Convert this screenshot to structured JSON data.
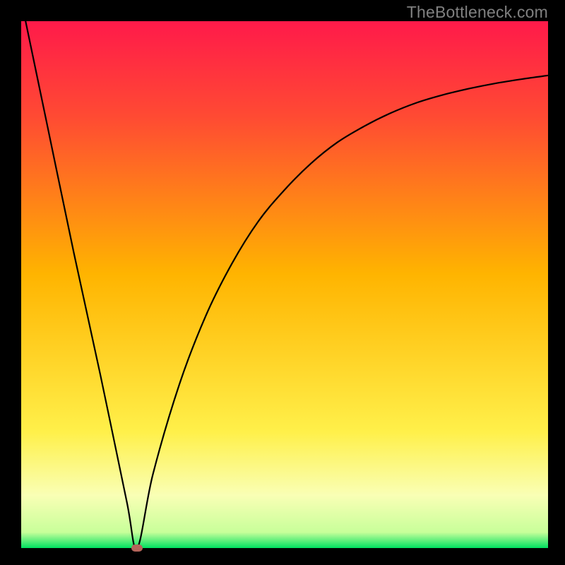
{
  "watermark": "TheBottleneck.com",
  "colors": {
    "frame": "#000000",
    "grad_top": "#ff1a4a",
    "grad_upper": "#ff5a2a",
    "grad_mid": "#ffb400",
    "grad_lower": "#fff04a",
    "grad_pale": "#f9ffb5",
    "grad_green": "#00e060",
    "curve": "#000000",
    "marker": "#b5645a"
  },
  "chart_data": {
    "type": "line",
    "title": "",
    "xlabel": "",
    "ylabel": "",
    "xlim": [
      0,
      100
    ],
    "ylim": [
      0,
      100
    ],
    "curve_min_x": 22,
    "marker": {
      "x": 22,
      "y": 0
    },
    "left_segment": {
      "x": [
        0,
        5,
        10,
        15,
        20,
        22
      ],
      "y": [
        104,
        80,
        56,
        33,
        9,
        0
      ]
    },
    "right_segment": {
      "x": [
        22,
        25,
        30,
        35,
        40,
        45,
        50,
        55,
        60,
        65,
        70,
        75,
        80,
        85,
        90,
        95,
        100
      ],
      "y": [
        0,
        14,
        31,
        44,
        54,
        62,
        68,
        73,
        77,
        80,
        82.5,
        84.5,
        86,
        87.2,
        88.2,
        89,
        89.7
      ]
    },
    "gradient_stops": [
      {
        "pct": 0,
        "color": "#ff1a4a"
      },
      {
        "pct": 18,
        "color": "#ff4a33"
      },
      {
        "pct": 48,
        "color": "#ffb400"
      },
      {
        "pct": 78,
        "color": "#fff04a"
      },
      {
        "pct": 90,
        "color": "#f9ffb5"
      },
      {
        "pct": 97,
        "color": "#c8ff9a"
      },
      {
        "pct": 100,
        "color": "#00e060"
      }
    ]
  }
}
